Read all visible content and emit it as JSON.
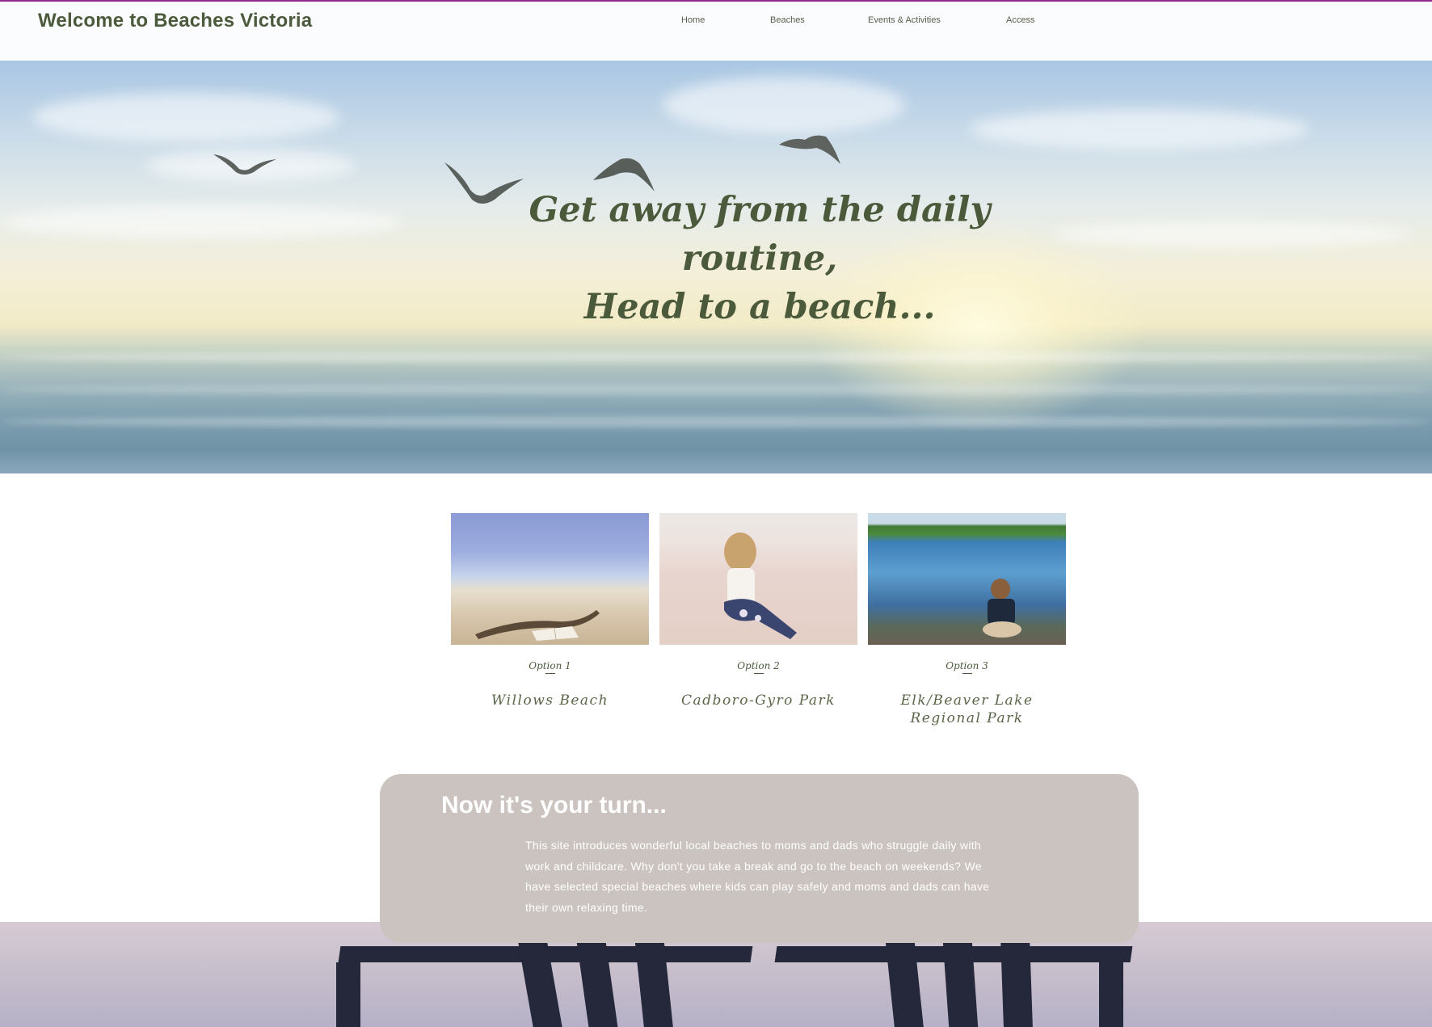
{
  "header": {
    "site_title": "Welcome to Beaches Victoria",
    "nav": [
      {
        "label": "Home"
      },
      {
        "label": "Beaches"
      },
      {
        "label": "Events & Activities"
      },
      {
        "label": "Access"
      }
    ]
  },
  "hero": {
    "line1": "Get away from the daily routine,",
    "line2": "Head to a beach..."
  },
  "cards": [
    {
      "option": "Option 1",
      "name": "Willows Beach",
      "image": "book-on-beach"
    },
    {
      "option": "Option 2",
      "name": "Cadboro-Gyro Park",
      "image": "girl-sitting-on-sand"
    },
    {
      "option": "Option 3",
      "name": "Elk/Beaver Lake Regional Park",
      "image": "boy-at-lake"
    }
  ],
  "turn": {
    "title": "Now it's your turn...",
    "body": "This site introduces wonderful local beaches to moms and dads who struggle daily with work and childcare. Why don't you take a break and go to the beach on weekends?  We have selected special beaches where kids can play safely and moms and dads can have their own relaxing time."
  },
  "colors": {
    "accent_line": "#8e2a8f",
    "title_green": "#4a5a3a",
    "turn_box": "#cbc3bf"
  }
}
